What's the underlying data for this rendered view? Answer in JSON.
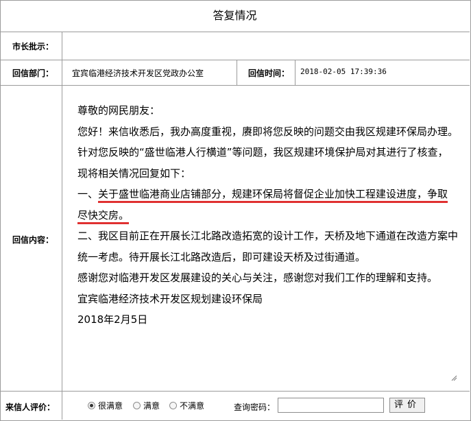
{
  "header": {
    "title": "答复情况"
  },
  "row_mayor": {
    "label": "市长批示：",
    "value": ""
  },
  "row_dept": {
    "label": "回信部门：",
    "value": "宜宾临港经济技术开发区党政办公室",
    "time_label": "回信时间：",
    "time_value": "2018-02-05 17:39:36"
  },
  "reply": {
    "label": "回信内容：",
    "greeting": "尊敬的网民朋友：",
    "p1": "您好！来信收悉后，我办高度重视，赓即将您反映的问题交由我区规建环保局办理。针对您反映的“盛世临港人行横道”等问题，我区规建环境保护局对其进行了核查，现将相关情况回复如下：",
    "p2_prefix": "一、",
    "p2_highlight": "关于盛世临港商业店铺部分，规建环保局将督促企业加快工程建设进度，争取尽快交房。",
    "p3": "二、我区目前正在开展长江北路改造拓宽的设计工作，天桥及地下通道在改造方案中统一考虑。待开展长江北路改造后，即可建设天桥及过街通道。",
    "p4": "感谢您对临港开发区发展建设的关心与关注，感谢您对我们工作的理解和支持。",
    "signature": "宜宾临港经济技术开发区规划建设环保局",
    "date": "2018年2月5日"
  },
  "evaluation": {
    "label": "来信人评价：",
    "options": [
      "很满意",
      "满意",
      "不满意"
    ],
    "selected": "很满意",
    "password_label": "查询密码：",
    "password_value": "",
    "button_label": "评价"
  },
  "colors": {
    "border": "#9a9a9a",
    "underline": "#e03030"
  }
}
